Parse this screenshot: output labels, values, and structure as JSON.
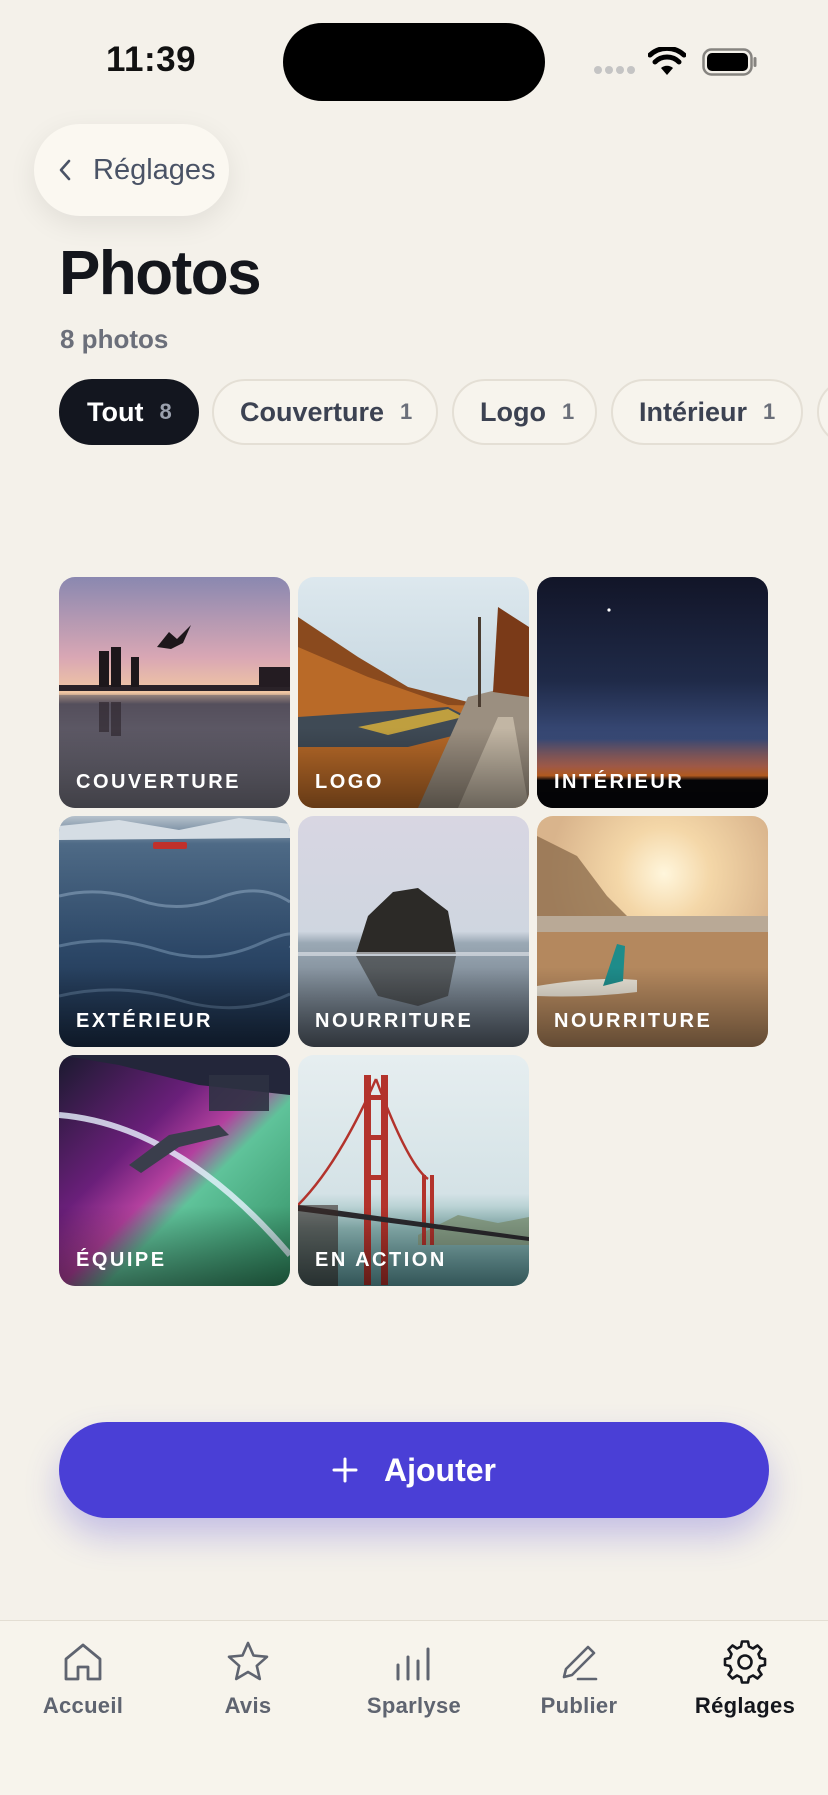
{
  "status_bar": {
    "time": "11:39"
  },
  "nav": {
    "back_label": "Réglages"
  },
  "header": {
    "title": "Photos",
    "count_text": "8 photos"
  },
  "filters": [
    {
      "label": "Tout",
      "count": "8",
      "active": true
    },
    {
      "label": "Couverture",
      "count": "1",
      "active": false
    },
    {
      "label": "Logo",
      "count": "1",
      "active": false
    },
    {
      "label": "Intérieur",
      "count": "1",
      "active": false
    }
  ],
  "photos": [
    {
      "label": "COUVERTURE",
      "scene": "sunset-lake-jump"
    },
    {
      "label": "LOGO",
      "scene": "autumn-river-road"
    },
    {
      "label": "INTÉRIEUR",
      "scene": "night-horizon"
    },
    {
      "label": "EXTÉRIEUR",
      "scene": "ocean-waves-boat"
    },
    {
      "label": "NOURRITURE",
      "scene": "sea-rock"
    },
    {
      "label": "NOURRITURE",
      "scene": "beach-surfboard-sunset"
    },
    {
      "label": "ÉQUIPE",
      "scene": "space-station-aurora"
    },
    {
      "label": "EN ACTION",
      "scene": "golden-gate-bridge"
    }
  ],
  "add_button": {
    "label": "Ajouter",
    "icon": "plus-icon"
  },
  "tabs": [
    {
      "label": "Accueil",
      "icon": "home-icon",
      "active": false
    },
    {
      "label": "Avis",
      "icon": "star-icon",
      "active": false
    },
    {
      "label": "Sparlyse",
      "icon": "bar-chart-icon",
      "active": false
    },
    {
      "label": "Publier",
      "icon": "pen-icon",
      "active": false
    },
    {
      "label": "Réglages",
      "icon": "gear-icon",
      "active": true
    }
  ],
  "colors": {
    "background": "#f4f1ea",
    "accent": "#4a3fd6",
    "chip_active": "#13161f",
    "text_primary": "#14161c",
    "text_muted": "#6b6f7a"
  }
}
